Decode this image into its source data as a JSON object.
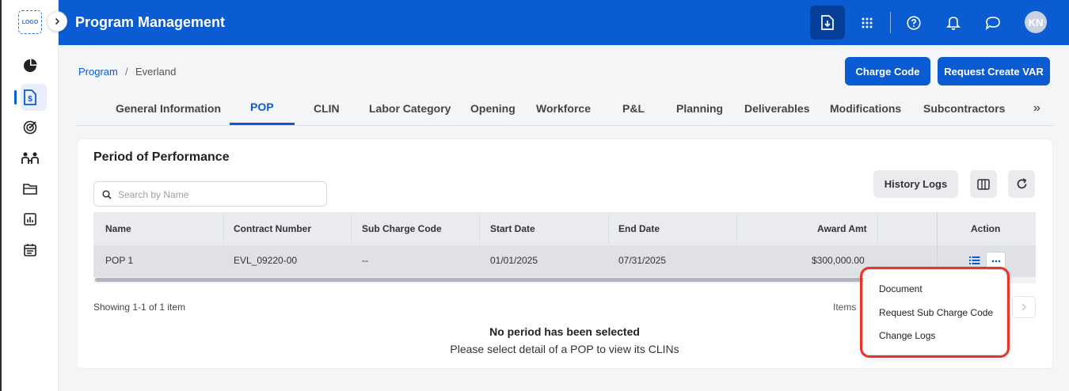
{
  "app": {
    "title": "Program Management",
    "logo_text": "LOGO",
    "avatar_initials": "KN"
  },
  "sidebar": {
    "icons": [
      "pie-chart-icon",
      "dollar-document-icon",
      "target-icon",
      "team-icon",
      "folder-icon",
      "report-chart-icon",
      "calendar-icon"
    ],
    "active": "dollar-document-icon"
  },
  "topbar_icons": [
    "download-icon",
    "apps-grid-icon",
    "help-icon",
    "bell-icon",
    "chat-icon"
  ],
  "breadcrumb": {
    "link": "Program",
    "separator": "/",
    "current": "Everland"
  },
  "actions": {
    "charge_code": "Charge Code",
    "request_create_var": "Request Create VAR"
  },
  "tabs": [
    {
      "label": "General Information"
    },
    {
      "label": "POP",
      "active": true
    },
    {
      "label": "CLIN"
    },
    {
      "label": "Labor Category"
    },
    {
      "label": "Opening"
    },
    {
      "label": "Workforce"
    },
    {
      "label": "P&L"
    },
    {
      "label": "Planning"
    },
    {
      "label": "Deliverables"
    },
    {
      "label": "Modifications"
    },
    {
      "label": "Subcontractors"
    }
  ],
  "tabs_more": "»",
  "section": {
    "title": "Period of Performance",
    "search_placeholder": "Search by Name",
    "history_logs": "History Logs"
  },
  "table": {
    "columns": [
      "Name",
      "Contract Number",
      "Sub Charge Code",
      "Start Date",
      "End Date",
      "Award Amt",
      "Action"
    ],
    "rows": [
      {
        "name": "POP 1",
        "contract_number": "EVL_09220-00",
        "sub_charge_code": "--",
        "start_date": "01/01/2025",
        "end_date": "07/31/2025",
        "award_amt": "$300,000.00"
      }
    ]
  },
  "pagination": {
    "showing": "Showing 1-1 of 1 item",
    "items_label": "Items"
  },
  "empty_state": {
    "title": "No period has been selected",
    "subtitle": "Please select detail of a POP to view its CLINs"
  },
  "row_menu": {
    "items": [
      "Document",
      "Request Sub Charge Code",
      "Change Logs"
    ]
  },
  "colors": {
    "primary": "#0b5bd3",
    "highlight": "#e8352a"
  }
}
